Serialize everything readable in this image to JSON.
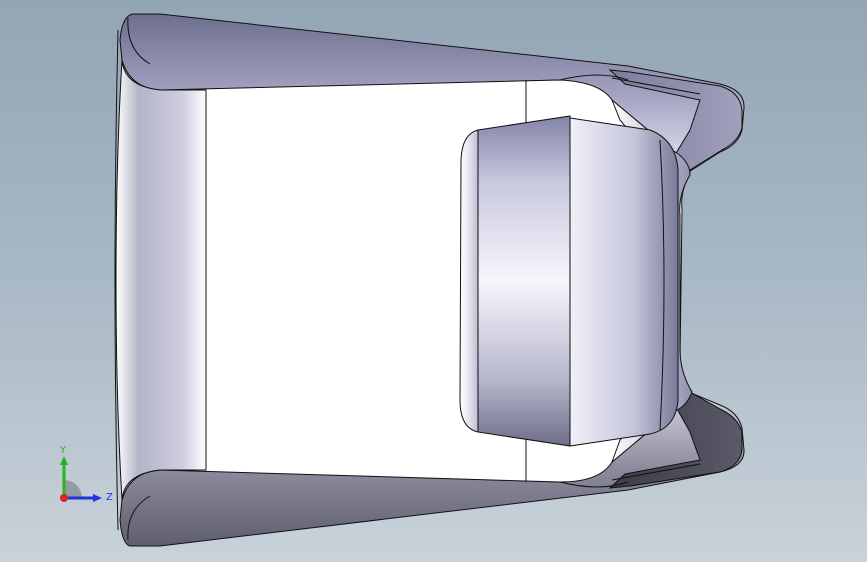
{
  "viewport": {
    "background_top": "#93a6b6",
    "background_bottom": "#c9d2da",
    "model_face_color": "#ffffff",
    "model_shade_color": "#8e8ea8",
    "edge_color": "#111111"
  },
  "triad": {
    "y_label": "Y",
    "z_label": "Z",
    "y_color": "#22b422",
    "z_color": "#2233dd",
    "x_color": "#dd2222"
  }
}
